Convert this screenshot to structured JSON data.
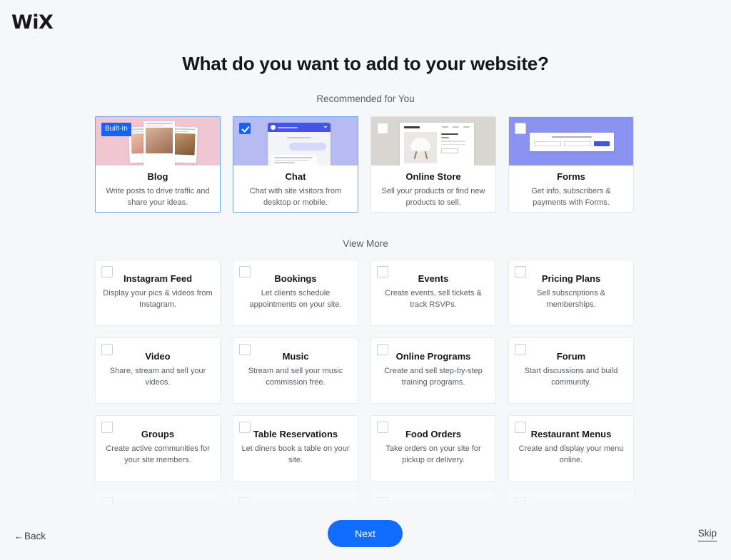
{
  "brand": {
    "logo_text": "WiX"
  },
  "header": {
    "title": "What do you want to add to your website?"
  },
  "sections": {
    "recommended_label": "Recommended for You",
    "view_more_label": "View More"
  },
  "badges": {
    "built_in": "Built-In"
  },
  "colors": {
    "accent": "#116dff",
    "checkbox_checked": "#1463f3",
    "highlight_border": "#6aa6f5",
    "page_background": "#f6f7f8",
    "card_background": "#ffffff",
    "title_text": "#16161b",
    "body_text": "#5a5c63"
  },
  "recommended": [
    {
      "title": "Blog",
      "desc": "Write posts to drive traffic and share your ideas.",
      "checked": false,
      "highlighted": true,
      "badge": "Built-In",
      "thumb": "blog-thumbnail"
    },
    {
      "title": "Chat",
      "desc": "Chat with site visitors from desktop or mobile.",
      "checked": true,
      "highlighted": true,
      "badge": "",
      "thumb": "chat-thumbnail"
    },
    {
      "title": "Online Store",
      "desc": "Sell your products or find new products to sell.",
      "checked": false,
      "highlighted": false,
      "badge": "",
      "thumb": "online-store-thumbnail"
    },
    {
      "title": "Forms",
      "desc": "Get info, subscribers & payments with Forms.",
      "checked": false,
      "highlighted": false,
      "badge": "",
      "thumb": "forms-thumbnail"
    }
  ],
  "view_more": [
    {
      "title": "Instagram Feed",
      "desc": "Display your pics & videos from Instagram.",
      "checked": false
    },
    {
      "title": "Bookings",
      "desc": "Let clients schedule appointments on your site.",
      "checked": false
    },
    {
      "title": "Events",
      "desc": "Create events, sell tickets & track RSVPs.",
      "checked": false
    },
    {
      "title": "Pricing Plans",
      "desc": "Sell subscriptions & memberships.",
      "checked": false
    },
    {
      "title": "Video",
      "desc": "Share, stream and sell your videos.",
      "checked": false
    },
    {
      "title": "Music",
      "desc": "Stream and sell your music commission free.",
      "checked": false
    },
    {
      "title": "Online Programs",
      "desc": "Create and sell step-by-step training programs.",
      "checked": false
    },
    {
      "title": "Forum",
      "desc": "Start discussions and build community.",
      "checked": false
    },
    {
      "title": "Groups",
      "desc": "Create active communities for your site members.",
      "checked": false
    },
    {
      "title": "Table Reservations",
      "desc": "Let diners book a table on your site.",
      "checked": false
    },
    {
      "title": "Food Orders",
      "desc": "Take orders on your site for pickup or delivery.",
      "checked": false
    },
    {
      "title": "Restaurant Menus",
      "desc": "Create and display your menu online.",
      "checked": false
    }
  ],
  "footer": {
    "back_label": "Back",
    "back_arrow": "←",
    "next_label": "Next",
    "skip_label": "Skip"
  }
}
